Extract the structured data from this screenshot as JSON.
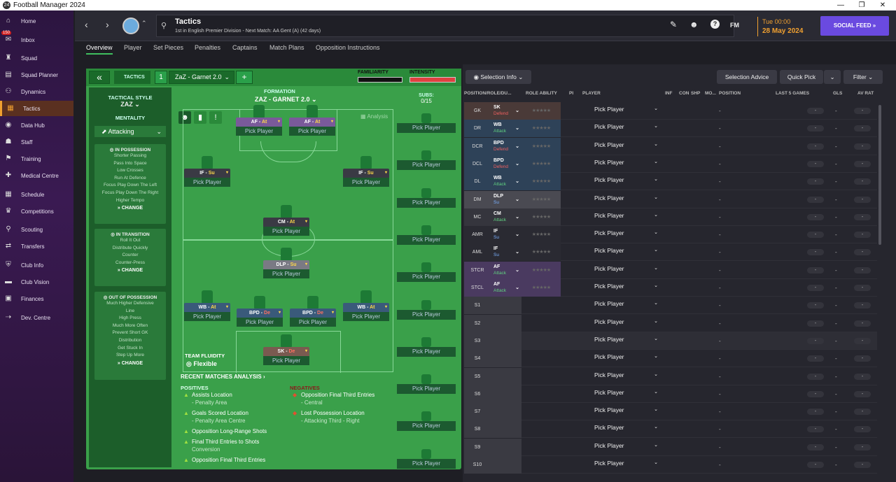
{
  "window": {
    "title": "Football Manager 2024",
    "logo": "24",
    "minimize": "—",
    "maximize": "❐",
    "close": "✕"
  },
  "sidebar": {
    "inbox_badge": "150",
    "items": [
      {
        "label": "Home",
        "icon": "home-icon",
        "glyph": "⌂"
      },
      {
        "label": "Inbox",
        "icon": "inbox-icon",
        "glyph": "✉"
      },
      {
        "label": "Squad",
        "icon": "shirt-icon",
        "glyph": "♜"
      },
      {
        "label": "Squad Planner",
        "icon": "planner-icon",
        "glyph": "▤"
      },
      {
        "label": "Dynamics",
        "icon": "dynamics-icon",
        "glyph": "⚇"
      },
      {
        "label": "Tactics",
        "icon": "tactics-icon",
        "glyph": "▦"
      },
      {
        "label": "Data Hub",
        "icon": "data-hub-icon",
        "glyph": "◉"
      },
      {
        "label": "Staff",
        "icon": "staff-icon",
        "glyph": "☗"
      },
      {
        "label": "Training",
        "icon": "training-icon",
        "glyph": "⚑"
      },
      {
        "label": "Medical Centre",
        "icon": "medical-icon",
        "glyph": "✚"
      },
      {
        "label": "Schedule",
        "icon": "schedule-icon",
        "glyph": "▦"
      },
      {
        "label": "Competitions",
        "icon": "trophy-icon",
        "glyph": "♛"
      },
      {
        "label": "Scouting",
        "icon": "scouting-icon",
        "glyph": "⚲"
      },
      {
        "label": "Transfers",
        "icon": "transfers-icon",
        "glyph": "⇄"
      },
      {
        "label": "Club Info",
        "icon": "club-info-icon",
        "glyph": "⛨"
      },
      {
        "label": "Club Vision",
        "icon": "club-vision-icon",
        "glyph": "▬"
      },
      {
        "label": "Finances",
        "icon": "finances-icon",
        "glyph": "▣"
      },
      {
        "label": "Dev. Centre",
        "icon": "dev-centre-icon",
        "glyph": "⇢"
      }
    ]
  },
  "header": {
    "back": "‹",
    "forward": "›",
    "club_switch": "⌃",
    "title": "Tactics",
    "subtitle": "1st in English Premier Division - Next Match: AA Gent (A) (42 days)",
    "day_time": "Tue 00:00",
    "date": "28 May 2024",
    "social": "SOCIAL FEED  »",
    "fm": "FM",
    "help": "?",
    "pen": "✎",
    "mic": "☻"
  },
  "tabs": [
    "Overview",
    "Player",
    "Set Pieces",
    "Penalties",
    "Captains",
    "Match Plans",
    "Opposition Instructions"
  ],
  "tactic_header": {
    "collapse": "«",
    "label": "TACTICS",
    "slot": "1",
    "name": "ZaZ - Garnet 2.0",
    "add": "+",
    "familiarity": "FAMILIARITY",
    "intensity": "INTENSITY"
  },
  "style": {
    "label": "TACTICAL STYLE",
    "value": "ZAZ",
    "mentality_label": "MENTALITY",
    "mentality": "Attacking"
  },
  "in_possession": {
    "title": "IN POSSESSION",
    "items": [
      "Shorter Passing",
      "Pass Into Space",
      "Low Crosses",
      "Run At Defence",
      "Focus Play Down The Left",
      "Focus Play Down The Right",
      "Higher Tempo"
    ],
    "change": "CHANGE"
  },
  "in_transition": {
    "title": "IN TRANSITION",
    "items": [
      "Roll It Out",
      "Distribute Quickly",
      "Counter",
      "Counter-Press"
    ],
    "change": "CHANGE"
  },
  "out_possession": {
    "title": "OUT OF POSSESSION",
    "items": [
      "Much Higher Defensive",
      "Line",
      "High Press",
      "Much More Often",
      "Prevent Short GK",
      "Distribution",
      "Get Stuck In",
      "Step Up More"
    ],
    "change": "CHANGE"
  },
  "formation": {
    "label": "FORMATION",
    "name": "ZAZ - GARNET 2.0",
    "analysis": "Analysis",
    "team_fluidity": "TEAM FLUIDITY",
    "fluidity": "Flexible",
    "subs_label": "SUBS:",
    "subs_count": "0/15"
  },
  "pitch_slots": [
    {
      "role": "AF",
      "duty": "At",
      "player": "Pick Player",
      "color": "#7a5a9a"
    },
    {
      "role": "AF",
      "duty": "At",
      "player": "Pick Player",
      "color": "#7a5a9a"
    },
    {
      "role": "IF",
      "duty": "Su",
      "player": "Pick Player",
      "color": "#3a3a44"
    },
    {
      "role": "IF",
      "duty": "Su",
      "player": "Pick Player",
      "color": "#3a3a44"
    },
    {
      "role": "CM",
      "duty": "At",
      "player": "Pick Player",
      "color": "#3a3a44"
    },
    {
      "role": "DLP",
      "duty": "Su",
      "player": "Pick Player",
      "color": "#7a7a84"
    },
    {
      "role": "WB",
      "duty": "At",
      "player": "Pick Player",
      "color": "#3a5a7a"
    },
    {
      "role": "BPD",
      "duty": "De",
      "player": "Pick Player",
      "color": "#3a5a7a"
    },
    {
      "role": "BPD",
      "duty": "De",
      "player": "Pick Player",
      "color": "#3a5a7a"
    },
    {
      "role": "WB",
      "duty": "At",
      "player": "Pick Player",
      "color": "#3a5a7a"
    },
    {
      "role": "SK",
      "duty": "De",
      "player": "Pick Player",
      "color": "#7a5a50"
    }
  ],
  "sub_slot_label": "Pick Player",
  "analysis": {
    "title": "RECENT MATCHES ANALYSIS ›",
    "pos_label": "POSITIVES",
    "neg_label": "NEGATIVES",
    "positives": [
      {
        "a": "Assists Location",
        "b": "- Penalty Area"
      },
      {
        "a": "Goals Scored Location",
        "b": "- Penalty Area Centre"
      },
      {
        "a": "Opposition Long-Range Shots",
        "b": ""
      },
      {
        "a": "Final Third Entries to Shots",
        "b": "Conversion"
      },
      {
        "a": "Opposition Final Third Entries",
        "b": ""
      }
    ],
    "negatives": [
      {
        "a": "Opposition Final Third Entries",
        "b": "- Central"
      },
      {
        "a": "Lost Possession Location",
        "b": "- Attacking Third - Right"
      }
    ]
  },
  "right": {
    "selection_info": "Selection Info",
    "selection_advice": "Selection Advice",
    "quick_pick": "Quick Pick",
    "filter": "Filter",
    "columns": [
      "POSITION/ROLE/DU...",
      "ROLE ABILITY",
      "PI",
      "PLAYER",
      "INF",
      "CON",
      "SHP",
      "MO...",
      "POSITION",
      "LAST 5 GAMES",
      "GLS",
      "AV RAT"
    ],
    "rows": [
      {
        "pos": "GK",
        "role": "SK",
        "duty": "Defend",
        "dc": "d",
        "bg": "#4a3a38"
      },
      {
        "pos": "DR",
        "role": "WB",
        "duty": "Attack",
        "dc": "at",
        "bg": "#2e4258"
      },
      {
        "pos": "DCR",
        "role": "BPD",
        "duty": "Defend",
        "dc": "d",
        "bg": "#2e4258"
      },
      {
        "pos": "DCL",
        "role": "BPD",
        "duty": "Defend",
        "dc": "d",
        "bg": "#2e4258"
      },
      {
        "pos": "DL",
        "role": "WB",
        "duty": "Attack",
        "dc": "at",
        "bg": "#2e4258"
      },
      {
        "pos": "DM",
        "role": "DLP",
        "duty": "Su",
        "dc": "su",
        "bg": "#4a4a52"
      },
      {
        "pos": "MC",
        "role": "CM",
        "duty": "Attack",
        "dc": "at",
        "bg": "#35353d"
      },
      {
        "pos": "AMR",
        "role": "IF",
        "duty": "Su",
        "dc": "su",
        "bg": "#2a2a32"
      },
      {
        "pos": "AML",
        "role": "IF",
        "duty": "Su",
        "dc": "su",
        "bg": "#2a2a32"
      },
      {
        "pos": "STCR",
        "role": "AF",
        "duty": "Attack",
        "dc": "at",
        "bg": "#4a3a60"
      },
      {
        "pos": "STCL",
        "role": "AF",
        "duty": "Attack",
        "dc": "at",
        "bg": "#4a3a60"
      },
      {
        "pos": "S1"
      },
      {
        "pos": "S2"
      },
      {
        "pos": "S3"
      },
      {
        "pos": "S4"
      },
      {
        "pos": "S5"
      },
      {
        "pos": "S6"
      },
      {
        "pos": "S7"
      },
      {
        "pos": "S8"
      },
      {
        "pos": "S9"
      },
      {
        "pos": "S10"
      }
    ],
    "pick": "Pick Player",
    "dash": "-",
    "stars": "★★★★★"
  }
}
